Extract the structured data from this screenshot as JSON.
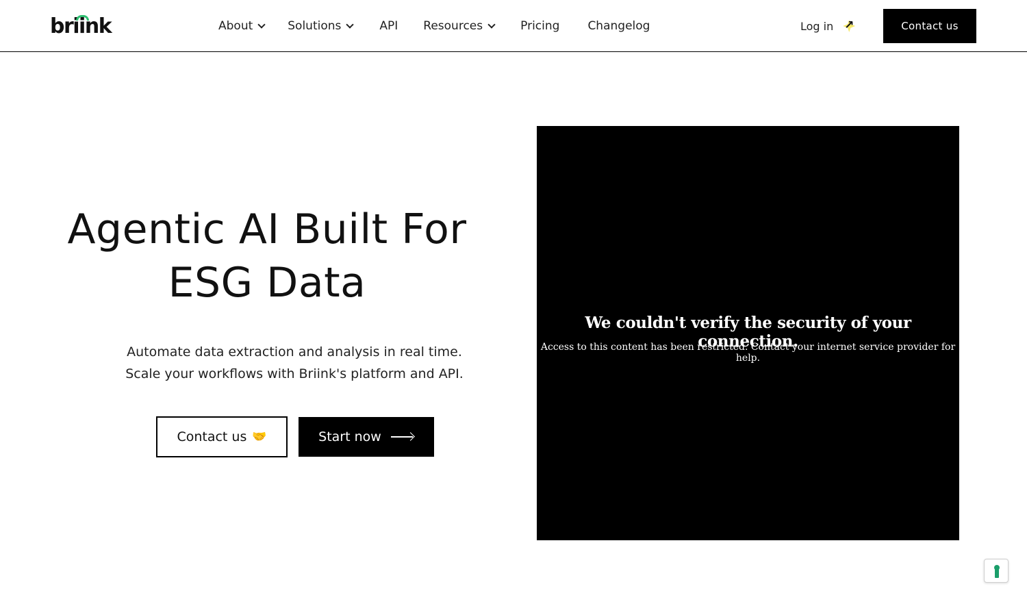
{
  "header": {
    "logo_text": "briink",
    "nav": [
      {
        "label": "About",
        "has_dropdown": true
      },
      {
        "label": "Solutions",
        "has_dropdown": true
      },
      {
        "label": "API",
        "has_dropdown": false
      },
      {
        "label": "Resources",
        "has_dropdown": true
      },
      {
        "label": "Pricing",
        "has_dropdown": false
      },
      {
        "label": "Changelog",
        "has_dropdown": false
      }
    ],
    "login_label": "Log in",
    "login_icon": "sparkle-arrow-icon",
    "contact_label": "Contact us"
  },
  "hero": {
    "title_line1": "Agentic AI Built For",
    "title_line2": "ESG Data",
    "subtitle_line1": "Automate data extraction and analysis in real time.",
    "subtitle_line2": "Scale your workflows with Briink's platform and API.",
    "contact_button": "Contact us",
    "contact_emoji": "🤝",
    "start_button": "Start now"
  },
  "media": {
    "title": "We couldn't verify the security of your connection.",
    "message": "Access to this content has been restricted. Contact your internet service provider for help."
  },
  "widget": {
    "icon": "accessibility-icon",
    "color": "#1a9e6a"
  },
  "colors": {
    "brand_green": "#2fbf71",
    "primary": "#000000",
    "background": "#ffffff"
  }
}
